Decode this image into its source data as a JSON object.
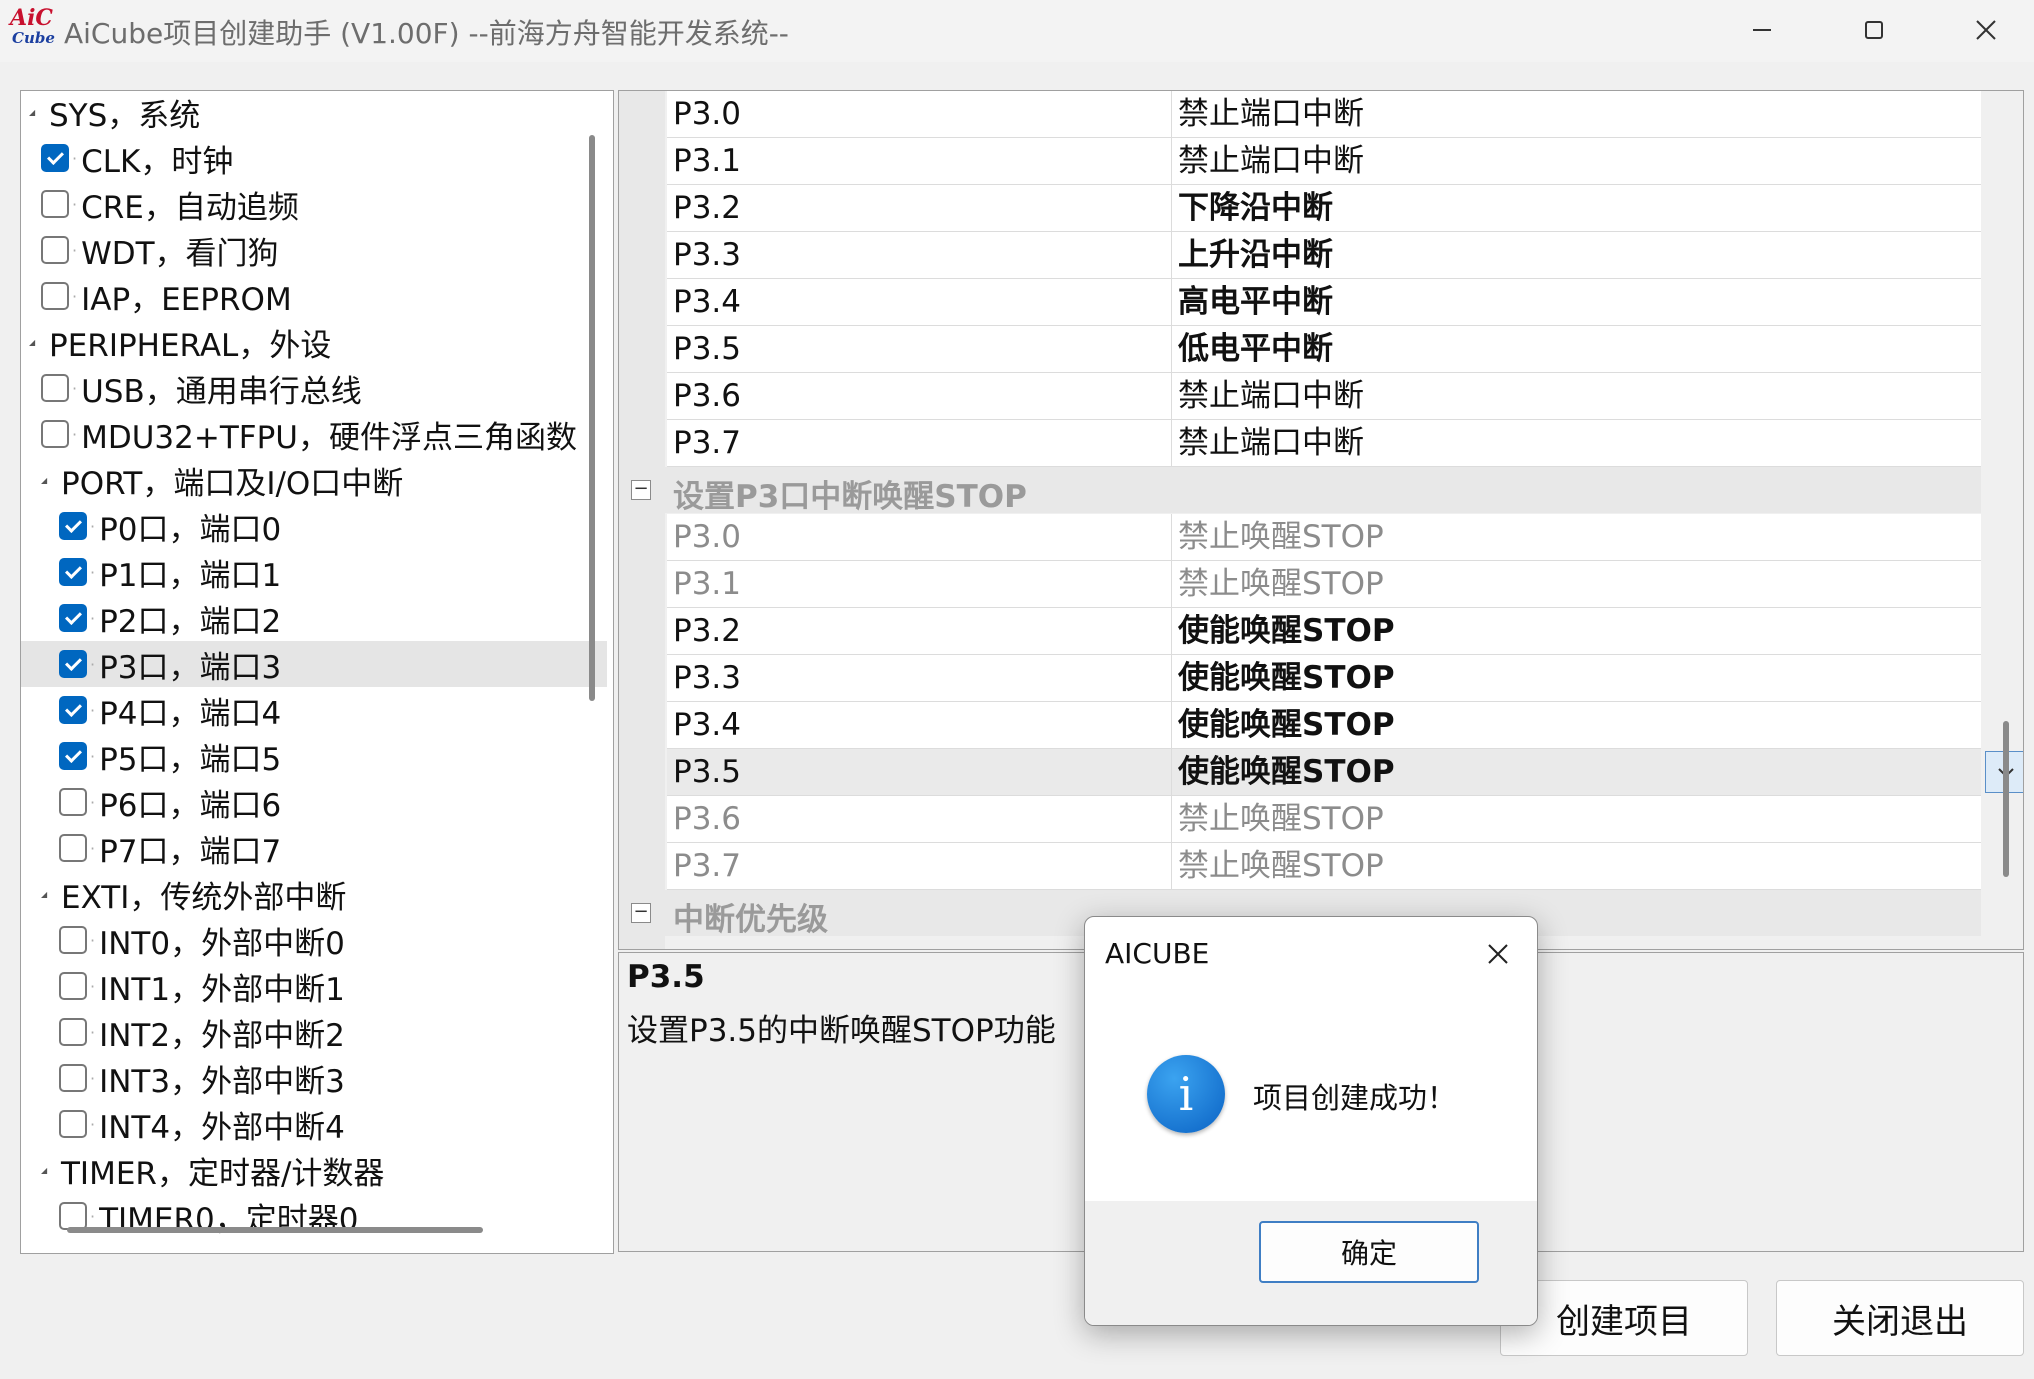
{
  "window": {
    "logo_top": "AiC",
    "logo_bottom": "Cube",
    "title": "AiCube项目创建助手 (V1.00F) --前海方舟智能开发系统--"
  },
  "tree": {
    "items": [
      {
        "label": "SYS，系统",
        "level": 0,
        "type": "group"
      },
      {
        "label": "CLK，时钟",
        "level": 1,
        "type": "check",
        "checked": true
      },
      {
        "label": "CRE，自动追频",
        "level": 1,
        "type": "check",
        "checked": false
      },
      {
        "label": "WDT，看门狗",
        "level": 1,
        "type": "check",
        "checked": false
      },
      {
        "label": "IAP，EEPROM",
        "level": 1,
        "type": "check",
        "checked": false
      },
      {
        "label": "PERIPHERAL，外设",
        "level": 0,
        "type": "group"
      },
      {
        "label": "USB，通用串行总线",
        "level": 1,
        "type": "check",
        "checked": false
      },
      {
        "label": "MDU32+TFPU，硬件浮点三角函数",
        "level": 1,
        "type": "check",
        "checked": false
      },
      {
        "label": "PORT，端口及I/O口中断",
        "level": 1,
        "type": "group"
      },
      {
        "label": "P0口，端口0",
        "level": 2,
        "type": "check",
        "checked": true
      },
      {
        "label": "P1口，端口1",
        "level": 2,
        "type": "check",
        "checked": true
      },
      {
        "label": "P2口，端口2",
        "level": 2,
        "type": "check",
        "checked": true
      },
      {
        "label": "P3口，端口3",
        "level": 2,
        "type": "check",
        "checked": true,
        "selected": true
      },
      {
        "label": "P4口，端口4",
        "level": 2,
        "type": "check",
        "checked": true
      },
      {
        "label": "P5口，端口5",
        "level": 2,
        "type": "check",
        "checked": true
      },
      {
        "label": "P6口，端口6",
        "level": 2,
        "type": "check",
        "checked": false
      },
      {
        "label": "P7口，端口7",
        "level": 2,
        "type": "check",
        "checked": false
      },
      {
        "label": "EXTI，传统外部中断",
        "level": 1,
        "type": "group"
      },
      {
        "label": "INT0，外部中断0",
        "level": 2,
        "type": "check",
        "checked": false
      },
      {
        "label": "INT1，外部中断1",
        "level": 2,
        "type": "check",
        "checked": false
      },
      {
        "label": "INT2，外部中断2",
        "level": 2,
        "type": "check",
        "checked": false
      },
      {
        "label": "INT3，外部中断3",
        "level": 2,
        "type": "check",
        "checked": false
      },
      {
        "label": "INT4，外部中断4",
        "level": 2,
        "type": "check",
        "checked": false
      },
      {
        "label": "TIMER，定时器/计数器",
        "level": 1,
        "type": "group"
      },
      {
        "label": "TIMER0，定时器0",
        "level": 2,
        "type": "check",
        "checked": false
      }
    ]
  },
  "grid": {
    "rows": [
      {
        "kind": "prop",
        "name": "P3.0",
        "value": "禁止端口中断",
        "bold": false,
        "disabled": false
      },
      {
        "kind": "prop",
        "name": "P3.1",
        "value": "禁止端口中断",
        "bold": false,
        "disabled": false
      },
      {
        "kind": "prop",
        "name": "P3.2",
        "value": "下降沿中断",
        "bold": true,
        "disabled": false
      },
      {
        "kind": "prop",
        "name": "P3.3",
        "value": "上升沿中断",
        "bold": true,
        "disabled": false
      },
      {
        "kind": "prop",
        "name": "P3.4",
        "value": "高电平中断",
        "bold": true,
        "disabled": false
      },
      {
        "kind": "prop",
        "name": "P3.5",
        "value": "低电平中断",
        "bold": true,
        "disabled": false
      },
      {
        "kind": "prop",
        "name": "P3.6",
        "value": "禁止端口中断",
        "bold": false,
        "disabled": false
      },
      {
        "kind": "prop",
        "name": "P3.7",
        "value": "禁止端口中断",
        "bold": false,
        "disabled": false
      },
      {
        "kind": "category",
        "name": "设置P3口中断唤醒STOP"
      },
      {
        "kind": "prop",
        "name": "P3.0",
        "value": "禁止唤醒STOP",
        "bold": false,
        "disabled": true
      },
      {
        "kind": "prop",
        "name": "P3.1",
        "value": "禁止唤醒STOP",
        "bold": false,
        "disabled": true
      },
      {
        "kind": "prop",
        "name": "P3.2",
        "value": "使能唤醒STOP",
        "bold": true,
        "disabled": false
      },
      {
        "kind": "prop",
        "name": "P3.3",
        "value": "使能唤醒STOP",
        "bold": true,
        "disabled": false
      },
      {
        "kind": "prop",
        "name": "P3.4",
        "value": "使能唤醒STOP",
        "bold": true,
        "disabled": false
      },
      {
        "kind": "prop",
        "name": "P3.5",
        "value": "使能唤醒STOP",
        "bold": true,
        "disabled": false,
        "selected": true
      },
      {
        "kind": "prop",
        "name": "P3.6",
        "value": "禁止唤醒STOP",
        "bold": false,
        "disabled": true
      },
      {
        "kind": "prop",
        "name": "P3.7",
        "value": "禁止唤醒STOP",
        "bold": false,
        "disabled": true
      },
      {
        "kind": "category",
        "name": "中断优先级"
      }
    ]
  },
  "description": {
    "title": "P3.5",
    "text": "设置P3.5的中断唤醒STOP功能"
  },
  "buttons": {
    "create": "创建项目",
    "exit": "关闭退出"
  },
  "dialog": {
    "title": "AICUBE",
    "icon": "info-icon",
    "message": "项目创建成功！",
    "ok": "确定"
  }
}
